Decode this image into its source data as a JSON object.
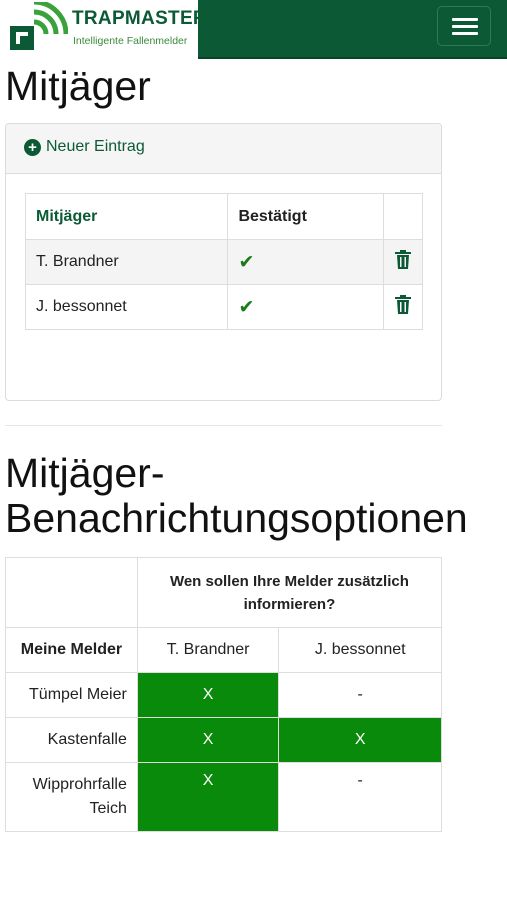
{
  "brand": {
    "name": "TRAPMASTER",
    "tagline": "Intelligente Fallenmelder"
  },
  "page_title": "Mitjäger",
  "panel": {
    "new_entry_label": "Neuer Eintrag",
    "columns": [
      "Mitjäger",
      "Bestätigt"
    ],
    "rows": [
      {
        "name": "T. Brandner",
        "confirmed": true
      },
      {
        "name": "J. bessonnet",
        "confirmed": true
      }
    ]
  },
  "options": {
    "title": "Mitjäger-Benachrichtungsoptionen",
    "question": "Wen sollen Ihre Melder zusätzlich informieren?",
    "row_header": "Meine Melder",
    "hunters": [
      "T. Brandner",
      "J. bessonnet"
    ],
    "rows": [
      {
        "melder": "Tümpel Meier",
        "values": [
          "X",
          "-"
        ]
      },
      {
        "melder": "Kastenfalle",
        "values": [
          "X",
          "X"
        ]
      },
      {
        "melder": "Wipprohrfalle Teich",
        "values": [
          "X",
          "-"
        ]
      }
    ]
  },
  "colors": {
    "brand_green": "#0b5a35",
    "active_cell": "#0a8a0a",
    "check": "#1a7a1a"
  }
}
